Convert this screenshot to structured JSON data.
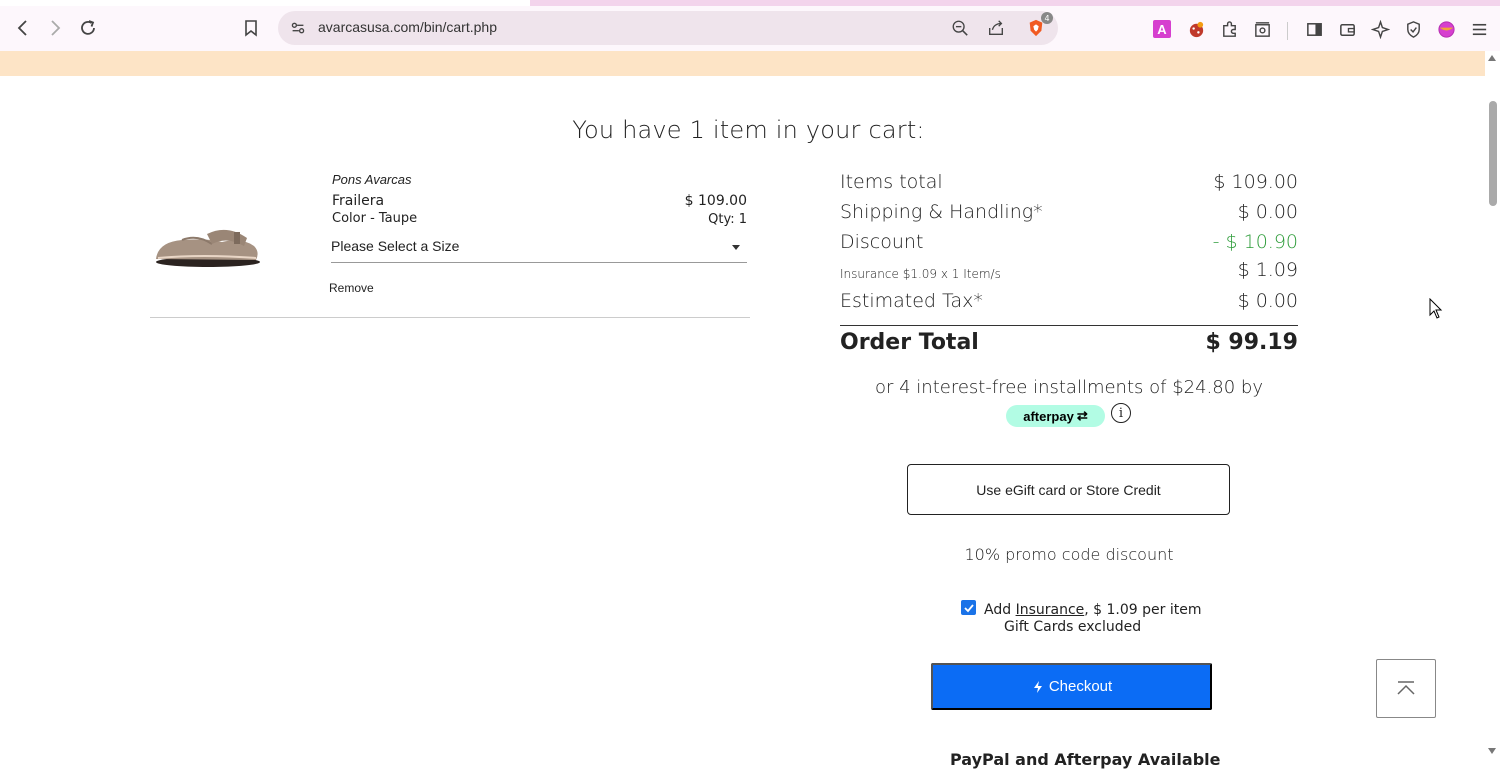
{
  "browser": {
    "url": "avarcasusa.com/bin/cart.php",
    "brave_count": "4",
    "ext_a_label": "A"
  },
  "page": {
    "heading": "You have 1 item in your cart:"
  },
  "cart_item": {
    "brand": "Pons Avarcas",
    "name": "Frailera",
    "price": "$ 109.00",
    "color": "Color - Taupe",
    "qty": "Qty: 1",
    "size_placeholder": "Please Select a Size",
    "remove_label": "Remove"
  },
  "summary": {
    "items_total_label": "Items total",
    "items_total_value": "$ 109.00",
    "shipping_label": "Shipping & Handling*",
    "shipping_value": "$ 0.00",
    "discount_label": "Discount",
    "discount_value": "- $ 10.90",
    "insurance_label": "Insurance $1.09 x 1 Item/s",
    "insurance_value": "$ 1.09",
    "tax_label": "Estimated Tax*",
    "tax_value": "$ 0.00",
    "order_total_label": "Order Total",
    "order_total_value": "$ 99.19",
    "installments_text": "or 4 interest-free installments of $24.80 by",
    "afterpay_label": "afterpay",
    "info_symbol": "i",
    "egift_button": "Use eGift card or Store Credit",
    "promo_text": "10% promo code discount",
    "insurance_add_prefix": "Add ",
    "insurance_link": "Insurance",
    "insurance_add_suffix": ", $ 1.09 per item",
    "insurance_sub": "Gift Cards excluded",
    "checkout_button": "Checkout",
    "paypal_note": "PayPal and Afterpay Available"
  },
  "colors": {
    "accent_blue": "#0b6cf5",
    "discount_green": "#2e9c3a",
    "banner": "#fde4c6",
    "afterpay_mint": "#b2fce4"
  }
}
